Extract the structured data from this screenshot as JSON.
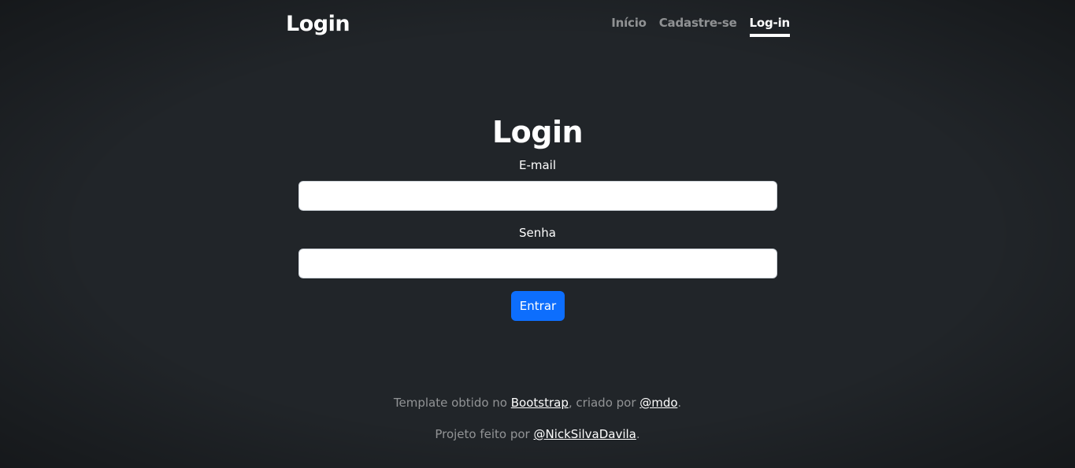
{
  "header": {
    "brand": "Login",
    "nav": [
      {
        "label": "Início",
        "active": false
      },
      {
        "label": "Cadastre-se",
        "active": false
      },
      {
        "label": "Log-in",
        "active": true
      }
    ]
  },
  "main": {
    "title": "Login",
    "email_label": "E-mail",
    "email_value": "",
    "password_label": "Senha",
    "password_value": "",
    "submit_label": "Entrar"
  },
  "footer": {
    "line1_prefix": "Template obtido no ",
    "line1_link1": "Bootstrap",
    "line1_middle": ", criado por ",
    "line1_link2": "@mdo",
    "line1_suffix": ".",
    "line2_prefix": "Projeto feito por ",
    "line2_link": "@NickSilvaDavila",
    "line2_suffix": "."
  },
  "colors": {
    "background": "#212529",
    "primary_button": "#0d6efd",
    "text": "#ffffff",
    "muted_text": "rgba(255,255,255,0.5)"
  }
}
